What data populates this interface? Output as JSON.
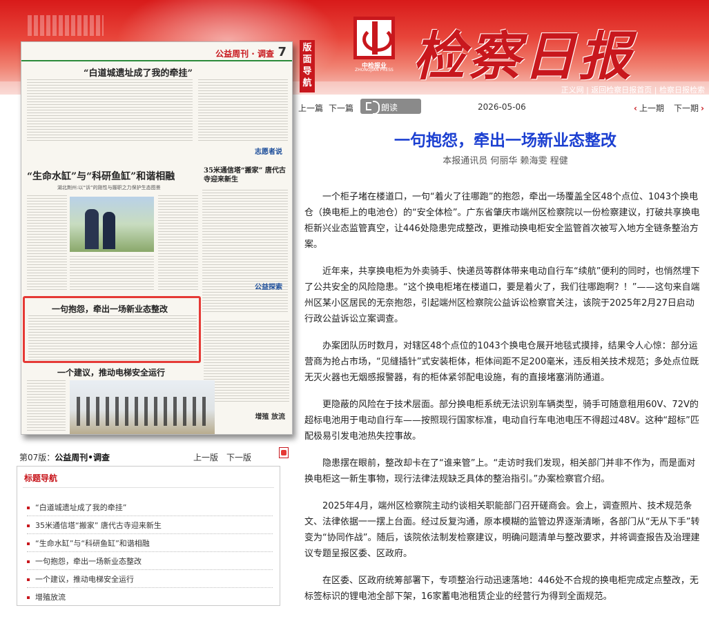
{
  "header": {
    "paper_name": "检察日报",
    "logo_cn": "中检报业",
    "logo_en": "ZHONGJIAN PRESS",
    "section_guide": "版面导航",
    "links": [
      "正义网",
      "返回检察日报首页",
      "检察日报检索"
    ]
  },
  "newspaper_page": {
    "weekly_title": "公益周刊 · 调查",
    "page_number": "7",
    "quote_title": "“白道城遗址成了我的牵挂”",
    "headline_left": "“生命水缸”与“科研鱼缸”和谐相融",
    "headline_left_sub": "湖北荆州:以“诉”的刚性与履职之力保护生态图景",
    "headline_right": "35米通信塔“搬家” 唐代古寺迎来新生",
    "column_right_1": "志愿者说",
    "column_right_2": "公益探索",
    "highlight_title": "一句抱怨，牵出一场新业态整改",
    "headline_bottom": "一个建议，推动电梯安全运行",
    "bottom_right": "增殖 放流"
  },
  "section_nav": {
    "label_prefix": "第07版：",
    "label_name": "公益周刊•调查",
    "prev": "上一版",
    "next": "下一版"
  },
  "toc": {
    "title": "标题导航",
    "items": [
      "“白道城遗址成了我的牵挂”",
      "35米通信塔“搬家” 唐代古寺迎来新生",
      "“生命水缸”与“科研鱼缸”和谐相融",
      "一句抱怨，牵出一场新业态整改",
      "一个建议，推动电梯安全运行",
      "增殖放流"
    ]
  },
  "article_nav": {
    "prev": "上一篇",
    "next": "下一篇",
    "read": "朗读",
    "date": "2026-05-06",
    "issue_prev": "上一期",
    "issue_next": "下一期"
  },
  "article": {
    "title": "一句抱怨，牵出一场新业态整改",
    "author": "本报通讯员 何丽华 赖海雯 程健",
    "paragraphs": [
      "一个柜子堵在楼道口，一句“着火了往哪跑”的抱怨，牵出一场覆盖全区48个点位、1043个换电仓（换电柜上的电池仓）的“安全体检”。广东省肇庆市端州区检察院以一份检察建议，打破共享换电柜新兴业态监管真空，让446处隐患完成整改，更推动换电柜安全监管首次被写入地方全链条整治方案。",
      "近年来，共享换电柜为外卖骑手、快递员等群体带来电动自行车“续航”便利的同时，也悄然埋下了公共安全的风险隐患。“这个换电柜堵在楼道口，要是着火了，我们往哪跑啊？！”——这句来自端州区某小区居民的无奈抱怨，引起端州区检察院公益诉讼检察官关注，该院于2025年2月27日启动行政公益诉讼立案调查。",
      "办案团队历时数月，对辖区48个点位的1043个换电仓展开地毯式摸排，结果令人心惊：部分运营商为抢占市场，“见缝插针”式安装柜体，柜体间距不足200毫米，违反相关技术规范；多处点位既无灭火器也无烟感报警器，有的柜体紧邻配电设施，有的直接堵塞消防通道。",
      "更隐蔽的风险在于技术层面。部分换电柜系统无法识别车辆类型，骑手可随意租用60V、72V的超标电池用于电动自行车——按照现行国家标准，电动自行车电池电压不得超过48V。这种“超标”匹配极易引发电池热失控事故。",
      "隐患摆在眼前，整改却卡在了“谁来管”上。“走访时我们发现，相关部门并非不作为，而是面对换电柜这一新生事物，现行法律法规缺乏具体的整治指引。”办案检察官介绍。",
      "2025年4月，端州区检察院主动约谈相关职能部门召开磋商会。会上，调查照片、技术规范条文、法律依据一一摆上台面。经过反复沟通，原本模糊的监管边界逐渐清晰，各部门从“无从下手”转变为“协同作战”。随后，该院依法制发检察建议，明确问题清单与整改要求，并将调查报告及治理建议专题呈报区委、区政府。",
      "在区委、区政府统筹部署下，专项整治行动迅速落地：446处不合规的换电柜完成定点整改，无标签标识的锂电池全部下架，16家蓄电池租赁企业的经营行为得到全面规范。"
    ]
  },
  "colors": {
    "brand_red": "#c8171d",
    "title_blue": "#1b3fd1",
    "highlight_border": "#e53935"
  }
}
